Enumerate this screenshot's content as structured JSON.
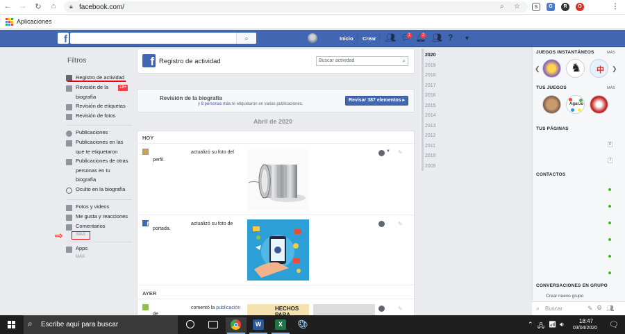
{
  "browser": {
    "url": "facebook.com/",
    "bookmarks_label": "Aplicaciones"
  },
  "fb_header": {
    "home": "Inicio",
    "create": "Crear",
    "messages_badge": "1",
    "notifications_badge": "2"
  },
  "filters": {
    "title": "Filtros",
    "items": [
      "Registro de actividad",
      "Revisión de la biografía",
      "Revisión de etiquetas",
      "Revisión de fotos",
      "Publicaciones",
      "Publicaciones en las que te etiquetaron",
      "Publicaciones de otras personas en tu biografía",
      "Oculto en la biografía",
      "Fotos y videos",
      "Me gusta y reacciones",
      "Comentarios",
      "Apps"
    ],
    "badge_18": "18+",
    "more_1": "MÁS",
    "more_2": "MÁS"
  },
  "activity_log": {
    "title": "Registro de actividad",
    "search_placeholder": "Buscar actividad",
    "review_title": "Revisión de la biografía",
    "review_sub_link": "8 personas más",
    "review_sub_prefix": "y ",
    "review_sub_suffix": " te etiquetaron en varias publicaciones.",
    "review_button": "Revisar 387 elementos",
    "month": "Abril de 2020",
    "today": "HOY",
    "yesterday": "AYER",
    "entries": [
      {
        "text": "actualizó su foto del",
        "sub": "perfil."
      },
      {
        "text": "actualizó su foto de",
        "sub": "portada."
      },
      {
        "text": "comentó la",
        "link": "publicación",
        "sub": "de"
      }
    ],
    "poster_text": "HECHOS PARA"
  },
  "years": [
    "2020",
    "2019",
    "2018",
    "2017",
    "2016",
    "2015",
    "2014",
    "2013",
    "2012",
    "2011",
    "2010",
    "2009"
  ],
  "right_sidebar": {
    "instant_games": "JUEGOS INSTANTÁNEOS",
    "your_games": "TUS JUEGOS",
    "your_pages": "TUS PÁGINAS",
    "contacts": "CONTACTOS",
    "group_convos": "CONVERSACIONES EN GRUPO",
    "more": "MÁS",
    "create_group": "Crear nuevo grupo",
    "search_placeholder": "Buscar",
    "game_label": "Agar.io",
    "page_count_1": "0",
    "page_count_2": "7"
  },
  "taskbar": {
    "search_text": "Escribe aquí para buscar",
    "time": "18:47",
    "date": "03/04/2020"
  },
  "colors": {
    "fb_blue": "#4267b2",
    "red_annotation": "#ee0000",
    "online_green": "#42b72a"
  }
}
